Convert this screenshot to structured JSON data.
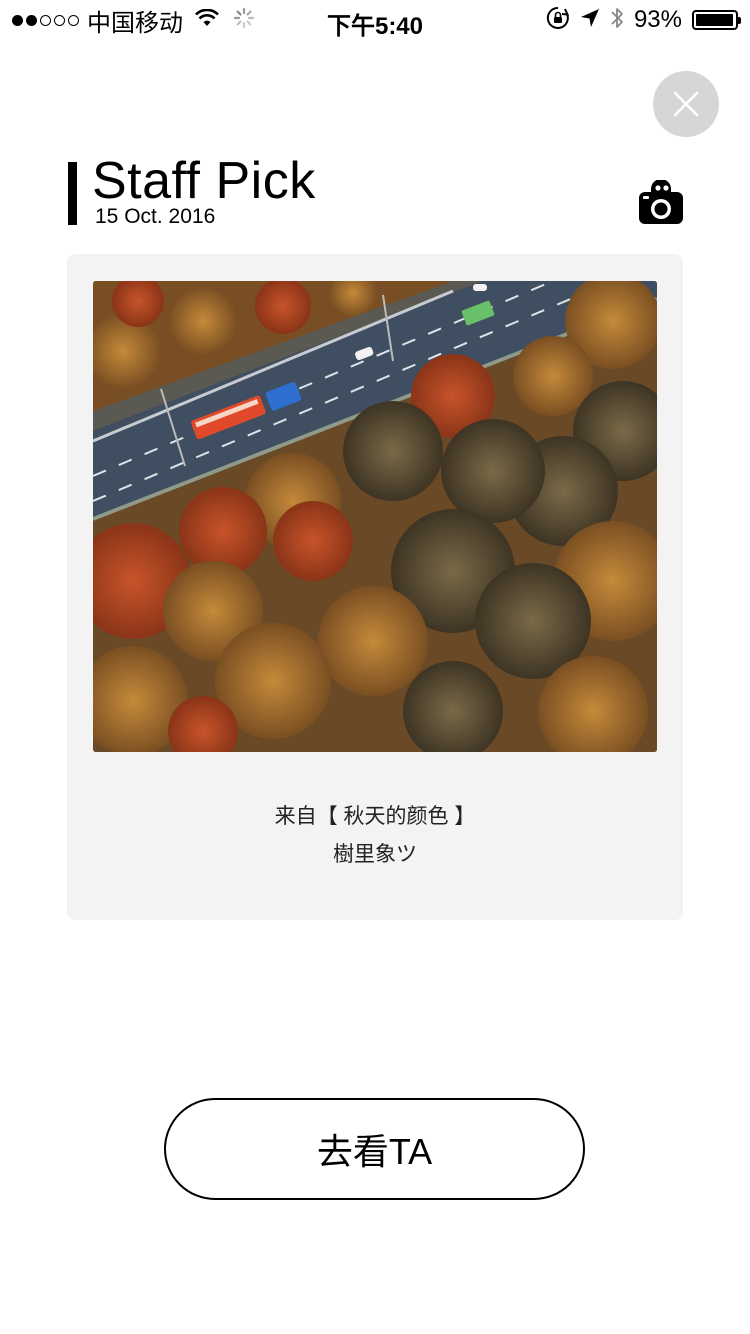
{
  "status_bar": {
    "carrier": "中国移动",
    "time": "下午5:40",
    "battery_percent": "93%",
    "signal_bars_filled": 2,
    "signal_bars_total": 5,
    "icons": [
      "wifi-icon",
      "loading-spinner-icon",
      "orientation-lock-icon",
      "location-arrow-icon",
      "bluetooth-icon",
      "battery-icon"
    ]
  },
  "close_button": {
    "icon": "close-icon"
  },
  "header": {
    "title": "Staff Pick",
    "date": "15 Oct. 2016",
    "icon": "camera-icon"
  },
  "card": {
    "photo": {
      "alt": "Aerial view of autumn trees beside a highway",
      "colors": {
        "foliage_red": "#b8471f",
        "foliage_orange": "#b7722f",
        "foliage_olive": "#6e5a35",
        "road": "#3f4e60"
      }
    },
    "source_text": "来自【 秋天的颜色 】",
    "author": "樹里象ツ"
  },
  "cta": {
    "label": "去看TA"
  }
}
